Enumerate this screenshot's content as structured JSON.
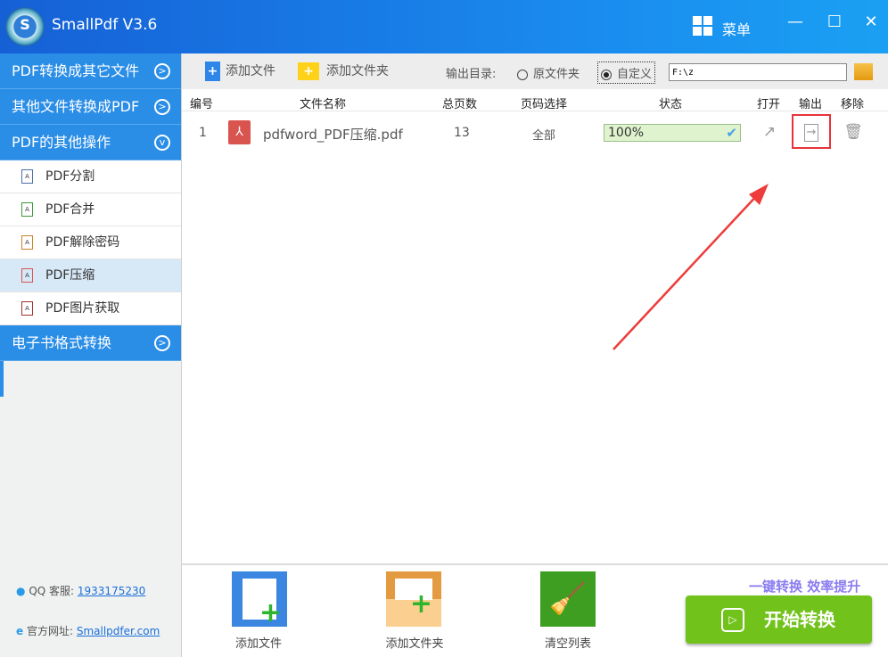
{
  "app": {
    "title": "SmallPdf V3.6",
    "logo_letter": "S",
    "menu_label": "菜单"
  },
  "sidebar": {
    "sections": [
      "PDF转换成其它文件",
      "其他文件转换成PDF",
      "PDF的其他操作",
      "电子书格式转换"
    ],
    "sub_items": [
      "PDF分割",
      "PDF合并",
      "PDF解除密码",
      "PDF压缩",
      "PDF图片获取"
    ],
    "selected": "PDF压缩",
    "qq_label": "QQ 客服:",
    "qq_number": "1933175230",
    "site_label": "官方网址:",
    "site_url": "Smallpdfer.com"
  },
  "toolbar": {
    "add_file": "添加文件",
    "add_folder": "添加文件夹",
    "output_dir_label": "输出目录:",
    "radio_original": "原文件夹",
    "radio_custom": "自定义",
    "output_path": "F:\\z"
  },
  "table": {
    "headers": [
      "编号",
      "文件名称",
      "总页数",
      "页码选择",
      "状态",
      "打开",
      "输出",
      "移除"
    ],
    "rows": [
      {
        "index": "1",
        "name": "pdfword_PDF压缩.pdf",
        "pages": "13",
        "range": "全部",
        "status": "100%",
        "progress": 100
      }
    ]
  },
  "bottom": {
    "add_file": "添加文件",
    "add_folder": "添加文件夹",
    "clear_list": "清空列表",
    "slogan": "一键转换  效率提升",
    "start": "开始转换"
  },
  "colors": {
    "accent": "#2a8de6",
    "start": "#72c21c",
    "highlight": "#e8333a"
  }
}
